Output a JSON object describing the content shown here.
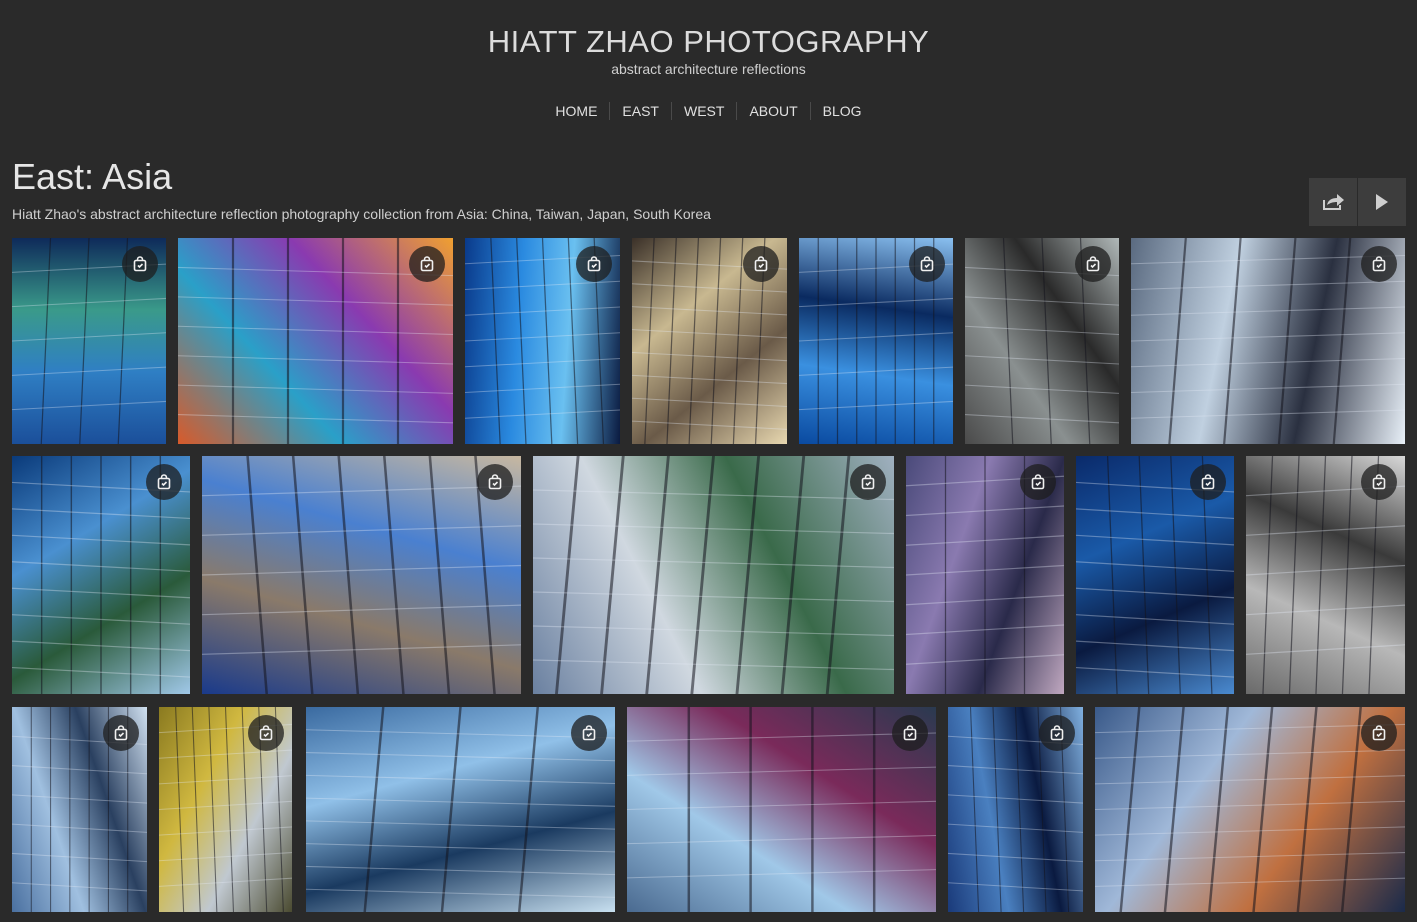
{
  "site": {
    "title": "HIATT ZHAO PHOTOGRAPHY",
    "tagline": "abstract architecture reflections"
  },
  "nav": {
    "items": [
      "HOME",
      "EAST",
      "WEST",
      "ABOUT",
      "BLOG"
    ]
  },
  "gallery": {
    "title": "East: Asia",
    "description": "Hiatt Zhao's abstract architecture reflection photography collection from Asia: China, Taiwan, Japan, South Korea"
  },
  "toolbar": {
    "share_icon": "share-icon",
    "slideshow_icon": "play-icon"
  },
  "photo_icon": "shopping-bag-icon",
  "photos": [
    {
      "id": 1,
      "colors": [
        "#1b4f9a",
        "#2f7fc4",
        "#3a9a8a",
        "#0e2a5a"
      ]
    },
    {
      "id": 2,
      "colors": [
        "#d85a2a",
        "#2aa0c8",
        "#8a3ab0",
        "#f0a030"
      ]
    },
    {
      "id": 3,
      "colors": [
        "#0a3a8a",
        "#2a8ae0",
        "#6ac0f0",
        "#0a1a40"
      ]
    },
    {
      "id": 4,
      "colors": [
        "#3a3028",
        "#c8b890",
        "#6a5a48",
        "#e8d8b0"
      ]
    },
    {
      "id": 5,
      "colors": [
        "#0a4aa0",
        "#3a90e0",
        "#0a2a60",
        "#8ac0f0"
      ]
    },
    {
      "id": 6,
      "colors": [
        "#4a4a4a",
        "#8a9090",
        "#2a2a2a",
        "#b0b8b8"
      ]
    },
    {
      "id": 7,
      "colors": [
        "#5a6a80",
        "#c0d0e0",
        "#2a3040",
        "#e8f0f8"
      ]
    },
    {
      "id": 8,
      "colors": [
        "#0a3a7a",
        "#4a90d0",
        "#2a5a3a",
        "#a0c8e8"
      ]
    },
    {
      "id": 9,
      "colors": [
        "#1a3a8a",
        "#8a7a6a",
        "#4a80d0",
        "#c8b8a0"
      ]
    },
    {
      "id": 10,
      "colors": [
        "#6a80a0",
        "#d0d8e0",
        "#3a6a4a",
        "#a0b0c0"
      ]
    },
    {
      "id": 11,
      "colors": [
        "#4a4a7a",
        "#8a7ab0",
        "#2a2a4a",
        "#c0a8c0"
      ]
    },
    {
      "id": 12,
      "colors": [
        "#0a2a6a",
        "#1a5aa8",
        "#0a1a40",
        "#4a8ad0"
      ]
    },
    {
      "id": 13,
      "colors": [
        "#6a6a6a",
        "#b8b8b8",
        "#3a3a3a",
        "#d8d8d8"
      ]
    },
    {
      "id": 14,
      "colors": [
        "#4a70a0",
        "#a0c0e0",
        "#2a4060",
        "#d0e0f0"
      ]
    },
    {
      "id": 15,
      "colors": [
        "#8a7a20",
        "#d0b840",
        "#c0c8d0",
        "#4a4a30"
      ]
    },
    {
      "id": 16,
      "colors": [
        "#3a6aa0",
        "#90c0e8",
        "#1a3a60",
        "#c8e0f0"
      ]
    },
    {
      "id": 17,
      "colors": [
        "#4a6a90",
        "#a0c8e8",
        "#7a2a5a",
        "#2a3a50"
      ]
    },
    {
      "id": 18,
      "colors": [
        "#1a3a7a",
        "#4a80c0",
        "#0a1a40",
        "#80b0e0"
      ]
    },
    {
      "id": 19,
      "colors": [
        "#3a5a8a",
        "#a0b8d8",
        "#c07040",
        "#1a2a4a"
      ]
    }
  ]
}
